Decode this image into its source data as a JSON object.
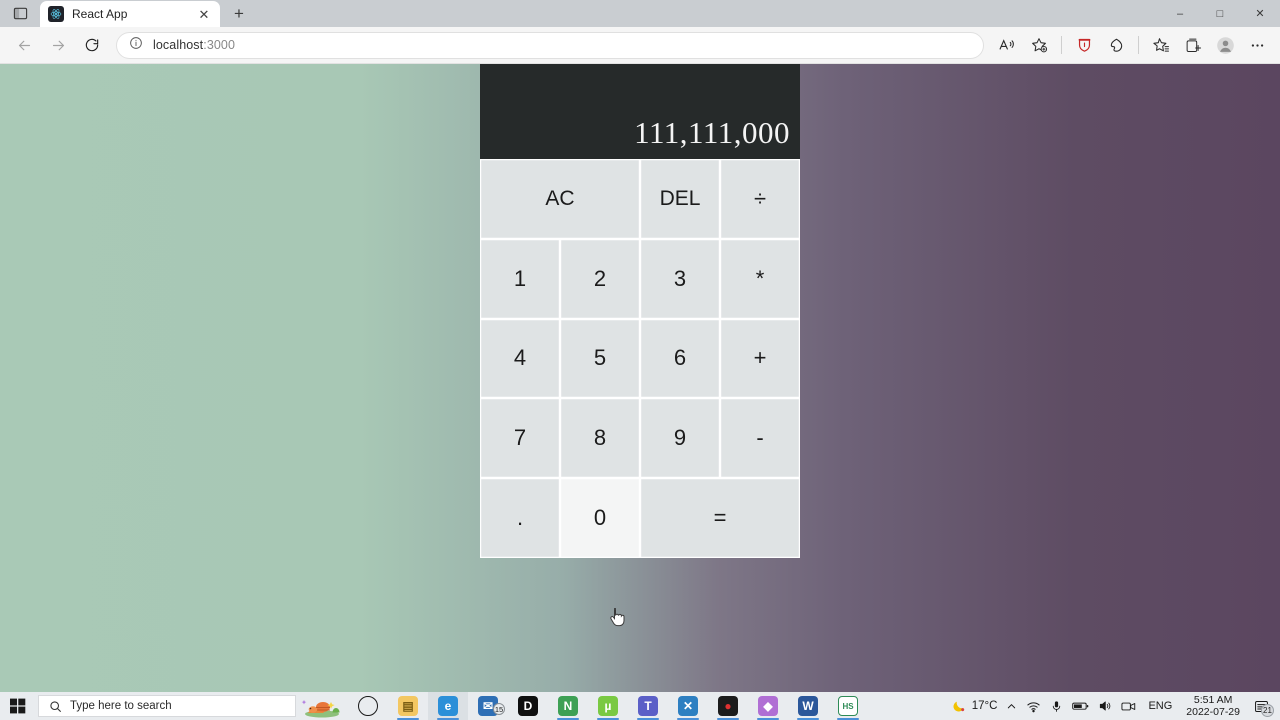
{
  "browser": {
    "tab_search_icon": "tab-search-icon",
    "tab": {
      "title": "React App",
      "favicon": "react-logo-icon",
      "close": "✕"
    },
    "new_tab": "+",
    "window_controls": {
      "minimize": "–",
      "maximize": "□",
      "close": "✕"
    },
    "nav": {
      "back": "back-arrow-icon",
      "forward": "forward-arrow-icon",
      "reload": "reload-icon"
    },
    "address": {
      "info_icon": "site-info-icon",
      "host": "localhost",
      "port": ":3000",
      "full": "localhost:3000"
    },
    "toolbar_icons": [
      {
        "name": "read-aloud-icon",
        "label": "Aᴰ"
      },
      {
        "name": "add-favorite-icon",
        "label": "☆"
      },
      {
        "name": "extension-red-icon",
        "label": "ext"
      },
      {
        "name": "edge-drop-icon",
        "label": "drop"
      },
      {
        "name": "favorites-icon",
        "label": "☆"
      },
      {
        "name": "collections-icon",
        "label": "⊞"
      },
      {
        "name": "profile-avatar",
        "label": "●"
      },
      {
        "name": "settings-more-icon",
        "label": "⋯"
      }
    ]
  },
  "calculator": {
    "display_value": "111,111,000",
    "buttons": [
      {
        "label": "AC",
        "name": "clear-all-button",
        "span": 2,
        "cls": "ac"
      },
      {
        "label": "DEL",
        "name": "delete-button",
        "span": 1,
        "cls": "del"
      },
      {
        "label": "÷",
        "name": "divide-button",
        "span": 1,
        "cls": "op"
      },
      {
        "label": "1",
        "name": "digit-1-button",
        "span": 1,
        "cls": "digit"
      },
      {
        "label": "2",
        "name": "digit-2-button",
        "span": 1,
        "cls": "digit"
      },
      {
        "label": "3",
        "name": "digit-3-button",
        "span": 1,
        "cls": "digit"
      },
      {
        "label": "*",
        "name": "multiply-button",
        "span": 1,
        "cls": "op"
      },
      {
        "label": "4",
        "name": "digit-4-button",
        "span": 1,
        "cls": "digit"
      },
      {
        "label": "5",
        "name": "digit-5-button",
        "span": 1,
        "cls": "digit"
      },
      {
        "label": "6",
        "name": "digit-6-button",
        "span": 1,
        "cls": "digit"
      },
      {
        "label": "+",
        "name": "add-button",
        "span": 1,
        "cls": "op"
      },
      {
        "label": "7",
        "name": "digit-7-button",
        "span": 1,
        "cls": "digit"
      },
      {
        "label": "8",
        "name": "digit-8-button",
        "span": 1,
        "cls": "digit"
      },
      {
        "label": "9",
        "name": "digit-9-button",
        "span": 1,
        "cls": "digit"
      },
      {
        "label": "-",
        "name": "subtract-button",
        "span": 1,
        "cls": "op"
      },
      {
        "label": ".",
        "name": "decimal-point-button",
        "span": 1,
        "cls": "dot"
      },
      {
        "label": "0",
        "name": "digit-0-button",
        "span": 1,
        "cls": "digit",
        "hovered": true
      },
      {
        "label": "=",
        "name": "equals-button",
        "span": 2,
        "cls": "op"
      }
    ]
  },
  "taskbar": {
    "start": "windows-start-icon",
    "search_placeholder": "Type here to search",
    "widget": "news-weather-widget",
    "apps": [
      {
        "name": "cortana-icon",
        "glyph": "○",
        "color": "transparent",
        "text": "#1a1a1a",
        "active": false,
        "running": false
      },
      {
        "name": "file-explorer-icon",
        "glyph": "▤",
        "color": "#f3c762",
        "text": "#7a5d12",
        "active": false,
        "running": true
      },
      {
        "name": "microsoft-edge-icon",
        "glyph": "e",
        "color": "#2b8fd8",
        "text": "#ffffff",
        "active": true,
        "running": true
      },
      {
        "name": "mail-icon",
        "glyph": "✉",
        "color": "#2f6fb5",
        "text": "#ffffff",
        "active": false,
        "running": false,
        "badge": "15"
      },
      {
        "name": "dell-icon",
        "glyph": "D",
        "color": "#0f0f0f",
        "text": "#ffffff",
        "active": false,
        "running": false
      },
      {
        "name": "node-chrome-icon",
        "glyph": "N",
        "color": "#3ea055",
        "text": "#ffffff",
        "active": false,
        "running": true
      },
      {
        "name": "utorrent-icon",
        "glyph": "µ",
        "color": "#7ac943",
        "text": "#ffffff",
        "active": false,
        "running": true
      },
      {
        "name": "microsoft-teams-icon",
        "glyph": "T",
        "color": "#5b5fc7",
        "text": "#ffffff",
        "active": false,
        "running": true
      },
      {
        "name": "vs-code-icon",
        "glyph": "✕",
        "color": "#2d7fc1",
        "text": "#ffffff",
        "active": false,
        "running": true
      },
      {
        "name": "media-player-icon",
        "glyph": "●",
        "color": "#1c1c1c",
        "text": "#e03131",
        "active": false,
        "running": true
      },
      {
        "name": "package-box-icon",
        "glyph": "◆",
        "color": "#b06fd4",
        "text": "#ffffff",
        "active": false,
        "running": true
      },
      {
        "name": "microsoft-word-icon",
        "glyph": "W",
        "color": "#2b579a",
        "text": "#ffffff",
        "active": false,
        "running": true
      },
      {
        "name": "hs-app-icon",
        "glyph": "HS",
        "color": "#ffffff",
        "text": "#2e8b57",
        "active": false,
        "running": true
      }
    ],
    "tray": {
      "weather_icon": "moon-weather-icon",
      "temperature": "17°C",
      "chevron": "⌃",
      "wifi_icon": "wifi-icon",
      "mic_icon": "microphone-icon",
      "battery_icon": "battery-icon",
      "volume_icon": "volume-icon",
      "meet_icon": "meet-now-icon",
      "language": "ENG",
      "time": "5:51 AM",
      "date": "2022-07-29",
      "notifications_icon": "notifications-icon",
      "notifications_count": "21"
    }
  }
}
